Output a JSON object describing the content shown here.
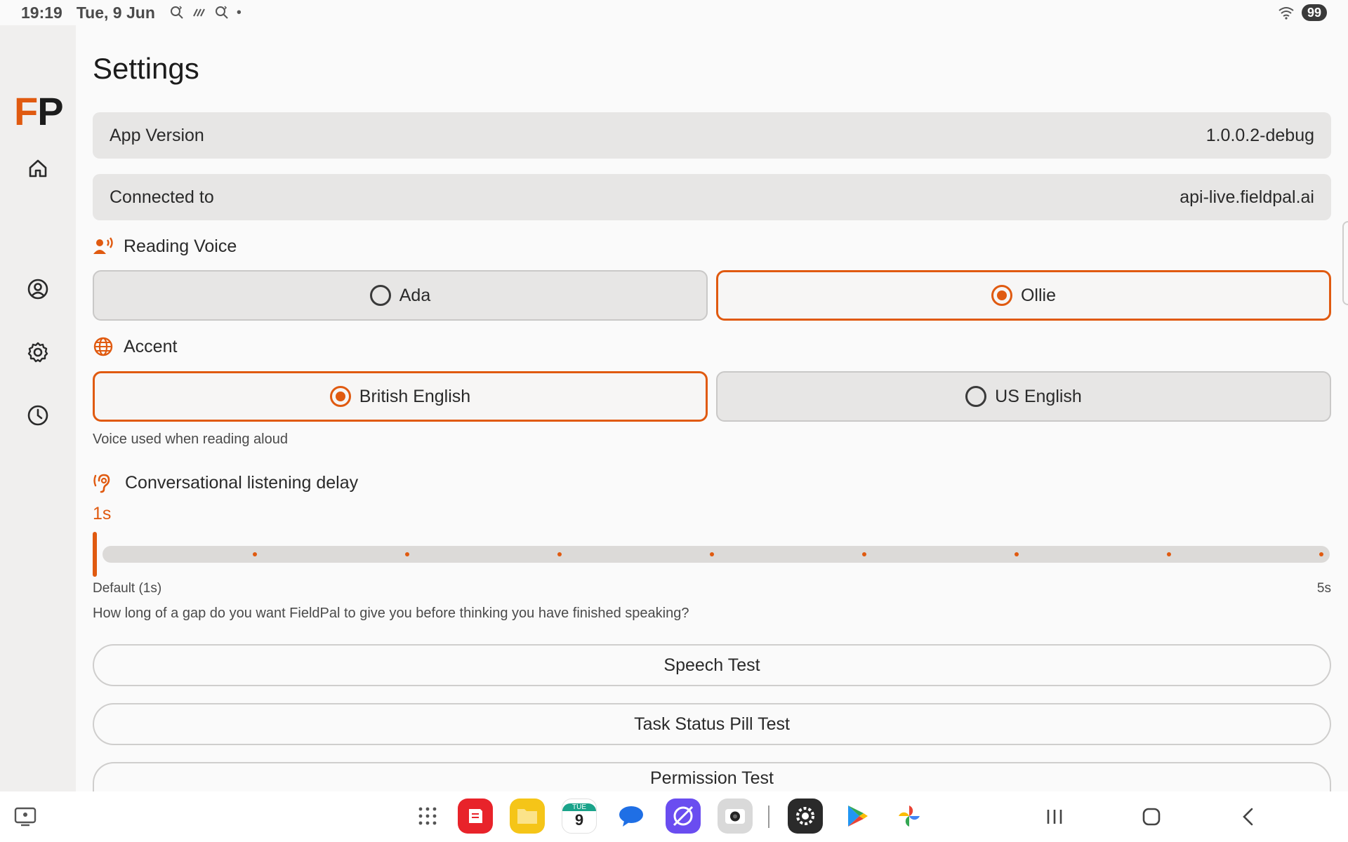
{
  "status_bar": {
    "time": "19:19",
    "date": "Tue, 9 Jun",
    "battery": "99",
    "notification_icons": [
      "notification-icon",
      "notification-icon",
      "notification-icon"
    ]
  },
  "rail": {
    "logo_f": "F",
    "logo_p": "P",
    "items": [
      "home-icon",
      "profile-icon",
      "settings-icon",
      "history-icon"
    ]
  },
  "page": {
    "title": "Settings"
  },
  "app_version": {
    "label": "App Version",
    "value": "1.0.0.2-debug"
  },
  "connected_to": {
    "label": "Connected to",
    "value": "api-live.fieldpal.ai"
  },
  "reading_voice": {
    "heading": "Reading Voice",
    "options": [
      {
        "label": "Ada",
        "selected": false
      },
      {
        "label": "Ollie",
        "selected": true
      }
    ]
  },
  "accent": {
    "heading": "Accent",
    "options": [
      {
        "label": "British English",
        "selected": true
      },
      {
        "label": "US English",
        "selected": false
      }
    ],
    "hint": "Voice used when reading aloud"
  },
  "listening_delay": {
    "heading": "Conversational listening delay",
    "value": "1s",
    "min_label": "Default (1s)",
    "max_label": "5s",
    "level_fraction": 0,
    "hint": "How long of a gap do you want FieldPal to give you before thinking you have finished speaking?"
  },
  "buttons": {
    "speech_test": "Speech Test",
    "task_status_pill_test": "Task Status Pill Test",
    "permission_test": "Permission Test"
  },
  "taskbar": {
    "calendar_day_abbr": "TUE",
    "calendar_day": "9"
  },
  "colors": {
    "accent": "#e05a10",
    "surface": "#e7e6e5",
    "background": "#fafafa"
  }
}
